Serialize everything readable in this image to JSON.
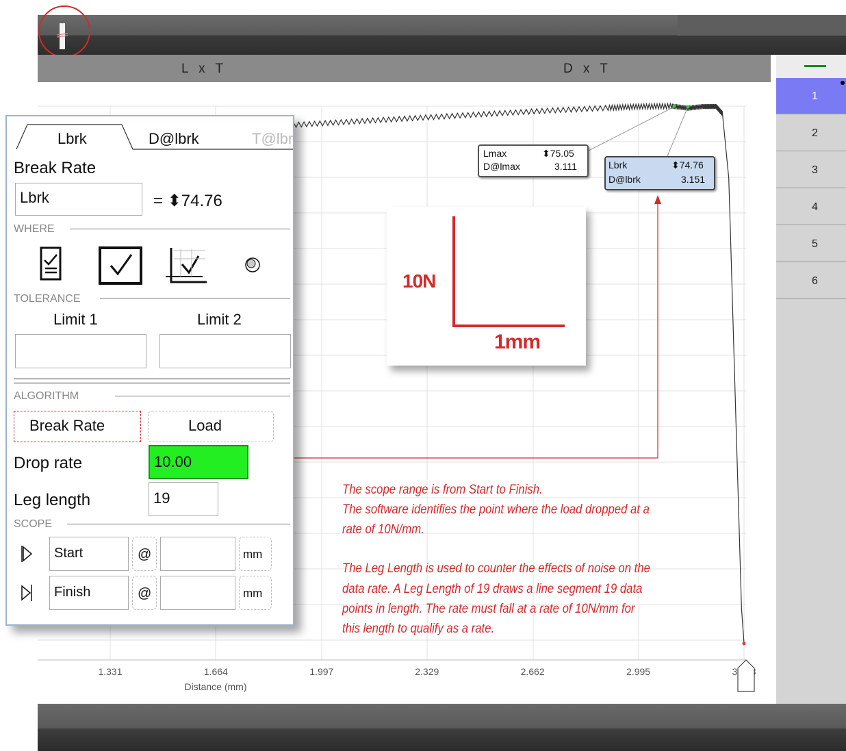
{
  "header": {
    "left_label": "L x T",
    "right_label": "D x T"
  },
  "right_panel": {
    "items": [
      "1",
      "2",
      "3",
      "4",
      "5",
      "6"
    ],
    "selected": "1"
  },
  "chart_data": {
    "type": "line",
    "xlabel": "Distance (mm)",
    "x_ticks": [
      "1.331",
      "1.664",
      "1.997",
      "2.329",
      "2.662",
      "2.995",
      "3.328"
    ],
    "series": [
      {
        "x": [
          1.1,
          1.3,
          1.5,
          1.7,
          1.9,
          2.1,
          2.3,
          2.5,
          2.7,
          2.9,
          3.0,
          3.1,
          3.151,
          3.2,
          3.24,
          3.26,
          3.28,
          3.3,
          3.32,
          3.328
        ],
        "y": [
          69.5,
          70.3,
          71.0,
          71.7,
          72.4,
          72.9,
          73.4,
          73.9,
          74.4,
          74.8,
          75.0,
          75.05,
          74.76,
          75.0,
          75.0,
          74.0,
          65.0,
          35.0,
          5.0,
          0.0
        ]
      }
    ]
  },
  "readouts": {
    "lmax": {
      "name1": "Lmax",
      "value1": "75.05",
      "name2": "D@lmax",
      "value2": "3.111"
    },
    "lbrk": {
      "name1": "Lbrk",
      "value1": "74.76",
      "name2": "D@lbrk",
      "value2": "3.151"
    }
  },
  "scale": {
    "vertical": "10N",
    "horizontal": "1mm"
  },
  "annotation": {
    "lines": [
      "The scope range is from Start to Finish.",
      "The software identifies the point where the load dropped at a",
      "rate of 10N/mm.",
      "The Leg Length is used to counter the effects of noise on the",
      "data rate.  A Leg Length of 19 draws a line segment 19 data",
      "points in length.  The rate must fall at a rate of 10N/mm for",
      "this length to qualify as a rate."
    ]
  },
  "dialog": {
    "tabs": [
      "Lbrk",
      "D@lbrk",
      "T@lbrk"
    ],
    "title": "Break Rate",
    "name_value": "Lbrk",
    "result": "= ",
    "result_value": "74.76",
    "where_label": "WHERE",
    "tolerance_label": "TOLERANCE",
    "limit1_label": "Limit 1",
    "limit2_label": "Limit 2",
    "limit1_value": "",
    "limit2_value": "",
    "algorithm_label": "ALGORITHM",
    "algo_option1": "Break Rate",
    "algo_option2": "Load",
    "drop_rate_label": "Drop rate",
    "drop_rate_value": "10.00",
    "leg_length_label": "Leg length",
    "leg_length_value": "19",
    "scope_label": "SCOPE",
    "start_label": "Start",
    "finish_label": "Finish",
    "at": "@",
    "unit": "mm",
    "start_value": "",
    "finish_value": ""
  }
}
